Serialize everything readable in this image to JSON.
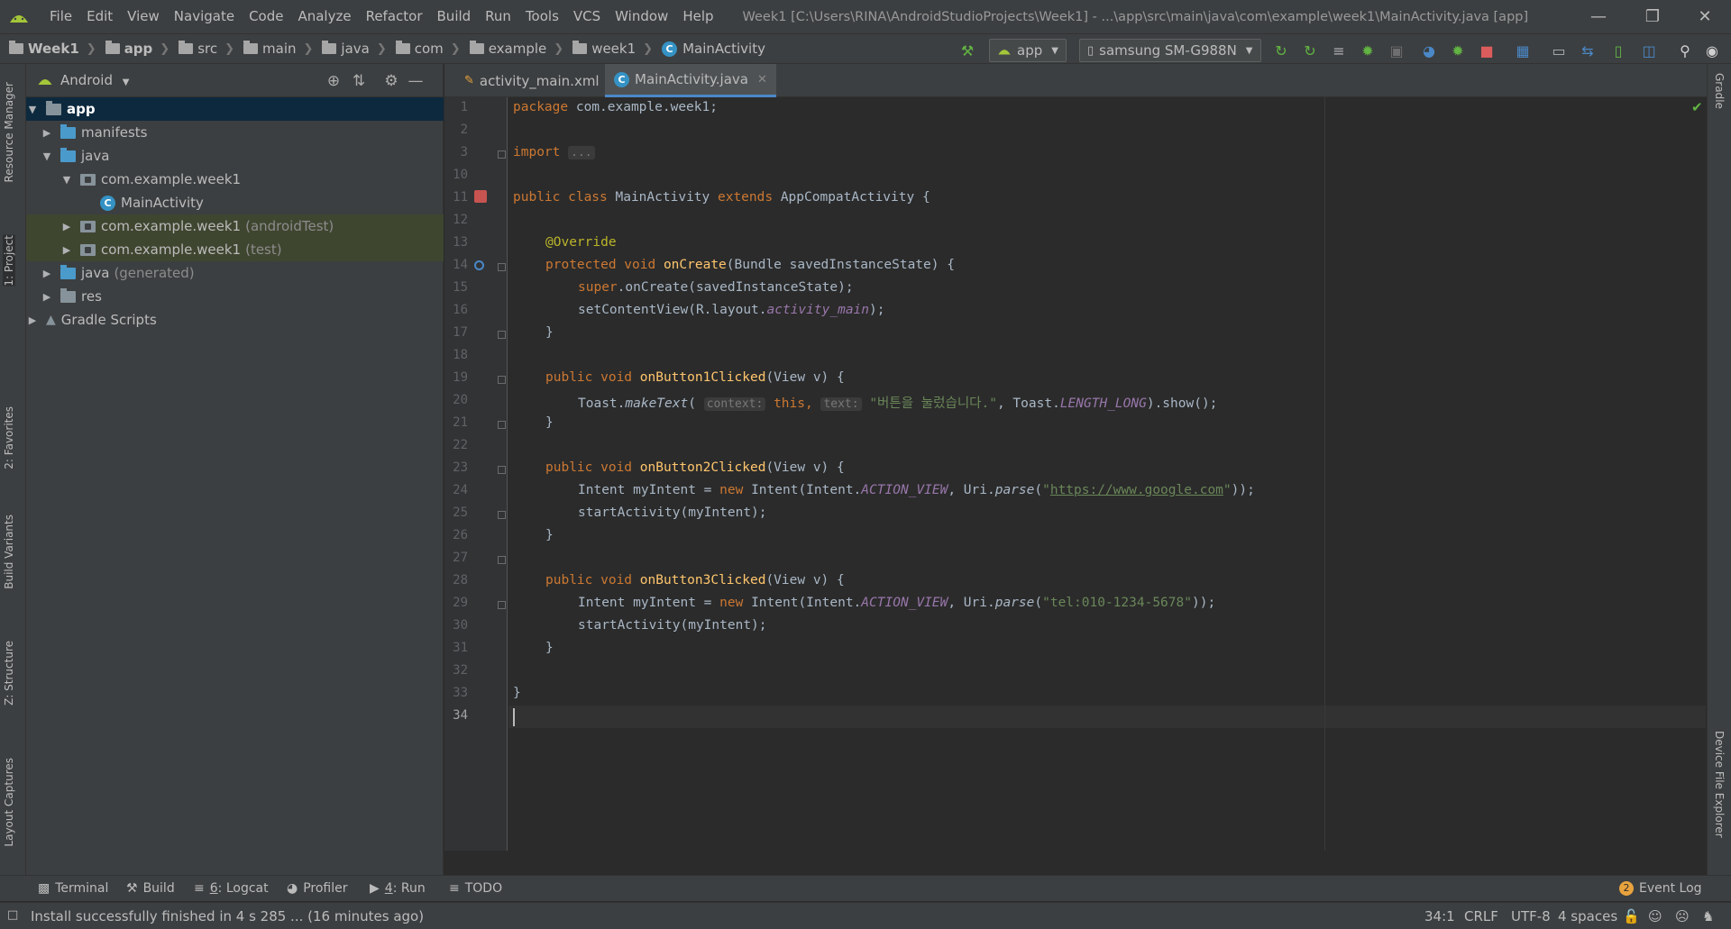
{
  "colors": {
    "accent": "#4a88c7",
    "selection": "#0d293e",
    "test_folder_bg": "#3f4630",
    "android_green": "#a4c639"
  },
  "menu": [
    {
      "label": "File"
    },
    {
      "label": "Edit"
    },
    {
      "label": "View"
    },
    {
      "label": "Navigate"
    },
    {
      "label": "Code"
    },
    {
      "label": "Analyze"
    },
    {
      "label": "Refactor"
    },
    {
      "label": "Build"
    },
    {
      "label": "Run"
    },
    {
      "label": "Tools"
    },
    {
      "label": "VCS"
    },
    {
      "label": "Window"
    },
    {
      "label": "Help"
    }
  ],
  "window_title": "Week1 [C:\\Users\\RINA\\AndroidStudioProjects\\Week1] - ...\\app\\src\\main\\java\\com\\example\\week1\\MainActivity.java [app]",
  "breadcrumbs": [
    "Week1",
    "app",
    "src",
    "main",
    "java",
    "com",
    "example",
    "week1",
    "MainActivity"
  ],
  "toolbar": {
    "run_config": "app",
    "device": "samsung SM-G988N",
    "icons": [
      "hammer-icon",
      "apply-changes-icon",
      "apply-code-changes-icon",
      "coverage-icon",
      "debug-icon",
      "attach-debugger-icon",
      "profiler-icon",
      "stop-icon",
      "sync-icon",
      "avd-manager-icon",
      "sdk-manager-icon",
      "structure-icon",
      "search-icon"
    ]
  },
  "left_tabs": [
    "Resource Manager",
    "1: Project",
    "2: Favorites",
    "Build Variants",
    "Z: Structure",
    "Layout Captures"
  ],
  "right_tabs": [
    "Gradle",
    "Device File Explorer"
  ],
  "project_panel": {
    "view_mode": "Android",
    "tree": [
      {
        "label": "app",
        "suffix": ""
      },
      {
        "label": "manifests",
        "suffix": ""
      },
      {
        "label": "java",
        "suffix": ""
      },
      {
        "label": "com.example.week1",
        "suffix": ""
      },
      {
        "label": "MainActivity",
        "suffix": ""
      },
      {
        "label": "com.example.week1",
        "suffix": "(androidTest)"
      },
      {
        "label": "com.example.week1",
        "suffix": "(test)"
      },
      {
        "label": "java",
        "suffix": "(generated)"
      },
      {
        "label": "res",
        "suffix": ""
      },
      {
        "label": "Gradle Scripts",
        "suffix": ""
      }
    ]
  },
  "editor": {
    "tabs": [
      {
        "label": "activity_main.xml",
        "active": false
      },
      {
        "label": "MainActivity.java",
        "active": true
      }
    ],
    "line_numbers": [
      "1",
      "2",
      "3",
      "10",
      "11",
      "12",
      "13",
      "14",
      "15",
      "16",
      "17",
      "18",
      "19",
      "20",
      "21",
      "22",
      "23",
      "24",
      "25",
      "26",
      "27",
      "28",
      "29",
      "30",
      "31",
      "32",
      "33",
      "34"
    ],
    "code": {
      "l1_kw": "package",
      "l1_rest": " com.example.week1;",
      "l3_kw": "import",
      "l3_folded": "...",
      "l11_kw": "public class",
      "l11_name": " MainActivity ",
      "l11_kw2": "extends",
      "l11_rest": " AppCompatActivity {",
      "l13_ann": "@Override",
      "l14_kw": "protected void",
      "l14_fn": "onCreate",
      "l14_rest": "(Bundle savedInstanceState) {",
      "l15_kw": "super",
      "l15_rest": ".onCreate(savedInstanceState);",
      "l16_pre": "setContentView(R.layout.",
      "l16_ital": "activity_main",
      "l16_post": ");",
      "l17": "}",
      "l19_kw": "public void",
      "l19_fn": "onButton1Clicked",
      "l19_rest": "(View v) {",
      "l20_pre": "Toast.",
      "l20_stat": "makeText",
      "l20_paren": "(",
      "l20_hint1": "context:",
      "l20_this": "this,",
      "l20_hint2": "text:",
      "l20_str": "\"버튼을 눌렀습니다.\"",
      "l20_mid": ", Toast.",
      "l20_ital": "LENGTH_LONG",
      "l20_post": ").show();",
      "l21": "}",
      "l23_kw": "public void",
      "l23_fn": "onButton2Clicked",
      "l23_rest": "(View v) {",
      "l24_pre": "Intent myIntent = ",
      "l24_kw": "new",
      "l24_mid": " Intent(Intent.",
      "l24_ital": "ACTION_VIEW",
      "l24_mid2": ", Uri.",
      "l24_stat": "parse",
      "l24_paren": "(",
      "l24_q1": "\"",
      "l24_link": "https://www.google.com",
      "l24_q2": "\"",
      "l24_post": "));",
      "l25": "startActivity(myIntent);",
      "l26": "}",
      "l28_kw": "public void",
      "l28_fn": "onButton3Clicked",
      "l28_rest": "(View v) {",
      "l29_pre": "Intent myIntent = ",
      "l29_kw": "new",
      "l29_mid": " Intent(Intent.",
      "l29_ital": "ACTION_VIEW",
      "l29_mid2": ", Uri.",
      "l29_stat": "parse",
      "l29_paren": "(",
      "l29_str": "\"tel:010-1234-5678\"",
      "l29_post": "));",
      "l30": "startActivity(myIntent);",
      "l31": "}",
      "l33": "}"
    }
  },
  "bottom_tools": [
    {
      "label": "Terminal",
      "num": ""
    },
    {
      "label": "Build",
      "num": ""
    },
    {
      "label": ": Logcat",
      "num": "6"
    },
    {
      "label": "Profiler",
      "num": ""
    },
    {
      "label": ": Run",
      "num": "4"
    },
    {
      "label": "TODO",
      "num": ""
    }
  ],
  "event_log": {
    "count": "2",
    "label": "Event Log"
  },
  "status": {
    "message": "Install successfully finished in 4 s 285 ... (16 minutes ago)",
    "caret": "34:1",
    "line_sep": "CRLF",
    "encoding": "UTF-8",
    "indent": "4 spaces"
  }
}
